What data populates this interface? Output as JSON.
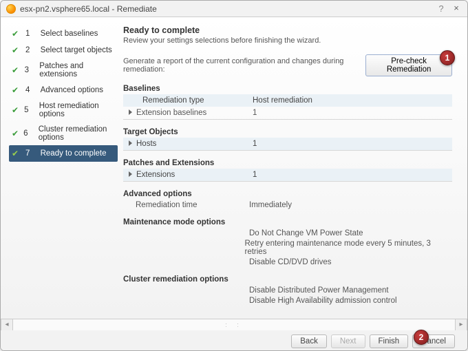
{
  "window": {
    "title": "esx-pn2.vsphere65.local - Remediate"
  },
  "nav": {
    "items": [
      {
        "num": "1",
        "label": "Select baselines"
      },
      {
        "num": "2",
        "label": "Select target objects"
      },
      {
        "num": "3",
        "label": "Patches and extensions"
      },
      {
        "num": "4",
        "label": "Advanced options"
      },
      {
        "num": "5",
        "label": "Host remediation options"
      },
      {
        "num": "6",
        "label": "Cluster remediation options"
      },
      {
        "num": "7",
        "label": "Ready to complete"
      }
    ]
  },
  "panel": {
    "heading": "Ready to complete",
    "subtitle": "Review your settings selections before finishing the wizard.",
    "generate_text": "Generate a report of the current configuration and changes during remediation:",
    "precheck_btn": "Pre-check Remediation"
  },
  "baselines": {
    "title": "Baselines",
    "rows": [
      {
        "k": "Remediation type",
        "v": "Host remediation"
      },
      {
        "k": "Extension baselines",
        "v": "1"
      }
    ]
  },
  "target": {
    "title": "Target Objects",
    "rows": [
      {
        "k": "Hosts",
        "v": "1"
      }
    ]
  },
  "patches": {
    "title": "Patches and Extensions",
    "rows": [
      {
        "k": "Extensions",
        "v": "1"
      }
    ]
  },
  "advanced": {
    "title": "Advanced options",
    "rows": [
      {
        "k": "Remediation time",
        "v": "Immediately"
      }
    ]
  },
  "mmode": {
    "title": "Maintenance mode options",
    "lines": [
      "Do Not Change VM Power State",
      "Retry entering maintenance mode every 5 minutes, 3 retries",
      "Disable CD/DVD drives"
    ]
  },
  "cluster": {
    "title": "Cluster remediation options",
    "lines": [
      "Disable Distributed Power Management",
      "Disable High Availability admission control"
    ]
  },
  "buttons": {
    "back": "Back",
    "next": "Next",
    "finish": "Finish",
    "cancel": "Cancel"
  },
  "callouts": {
    "c1": "1",
    "c2": "2"
  }
}
